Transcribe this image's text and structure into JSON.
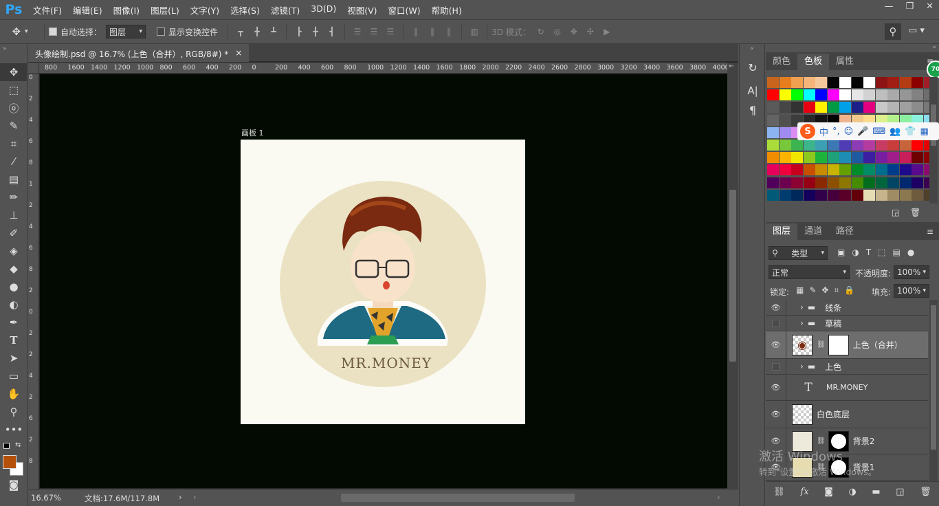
{
  "app": {
    "logo": "Ps"
  },
  "menu": [
    "文件(F)",
    "编辑(E)",
    "图像(I)",
    "图层(L)",
    "文字(Y)",
    "选择(S)",
    "滤镜(T)",
    "3D(D)",
    "视图(V)",
    "窗口(W)",
    "帮助(H)"
  ],
  "window_controls": {
    "minimize": "—",
    "restore": "❐",
    "close": "✕"
  },
  "options": {
    "auto_select_label": "自动选择：",
    "auto_select_checked": true,
    "auto_select_target": "图层",
    "show_transform_label": "显示变换控件",
    "show_transform_checked": false,
    "mode3d_label": "3D 模式："
  },
  "document": {
    "tab_title": "头像绘制.psd @ 16.7% (上色（合并）, RGB/8#) *",
    "tab_close": "×",
    "artboard_label": "画板 1",
    "ruler_h": [
      "800",
      "1600",
      "1400",
      "1200",
      "1000",
      "800",
      "600",
      "400",
      "200",
      "0",
      "200",
      "400",
      "600",
      "800",
      "1000",
      "1200",
      "1400",
      "1600",
      "1800",
      "2000",
      "2200",
      "2400",
      "2600",
      "2800",
      "3000",
      "3200",
      "3400",
      "3600",
      "3800",
      "4000"
    ],
    "ruler_v": [
      "0",
      "2",
      "4",
      "6",
      "8",
      "1",
      "2",
      "4",
      "6",
      "8",
      "2",
      "0",
      "2",
      "2",
      "4",
      "2",
      "6",
      "2",
      "8"
    ],
    "artwork_text": "MR.MONEY"
  },
  "status": {
    "zoom": "16.67%",
    "doc_size": "文档:17.6M/117.8M"
  },
  "panels": {
    "top_tabs": [
      "颜色",
      "色板",
      "属性"
    ],
    "top_active": "色板",
    "layer_tabs": [
      "图层",
      "通道",
      "路径"
    ],
    "layer_active": "图层",
    "filter_kind": "类型",
    "blend_mode": "正常",
    "opacity_label": "不透明度:",
    "opacity_value": "100%",
    "lock_label": "锁定:",
    "fill_label": "填充:",
    "fill_value": "100%"
  },
  "layers": [
    {
      "name": "线条",
      "type": "group",
      "visible": true
    },
    {
      "name": "草稿",
      "type": "group",
      "visible": false
    },
    {
      "name": "上色（合并）",
      "type": "image-mask",
      "visible": true,
      "selected": true
    },
    {
      "name": "上色",
      "type": "group",
      "visible": false
    },
    {
      "name": "MR.MONEY",
      "type": "text",
      "visible": true
    },
    {
      "name": "白色底层",
      "type": "image",
      "visible": true
    },
    {
      "name": "背景2",
      "type": "image-mask",
      "visible": true
    },
    {
      "name": "背景1",
      "type": "image-mask",
      "visible": true
    }
  ],
  "ime_bar": {
    "logo": "S",
    "lang": "中",
    "punct": "°,"
  },
  "watermark": {
    "line1": "激活 Windows",
    "line2": "转到\"设置\"以激活 Windows。"
  },
  "swatch_colors": [
    [
      "#c8641e",
      "#e87d1e",
      "#f0a050",
      "#f5b47a",
      "#f5c89b",
      "#050505",
      "#ffffff",
      "#050505",
      "#ffffff",
      "#8c1414",
      "#a01e14",
      "#b43c14",
      "#8c0000",
      "#a01e28"
    ],
    [
      "#ff0000",
      "#ffff00",
      "#00ff00",
      "#00ffff",
      "#0000ff",
      "#ff00ff",
      "#ffffff",
      "#e6e6e6",
      "#d2d2d2",
      "#bebebe",
      "#aaaaaa",
      "#969696",
      "#828282",
      "#6e6e6e"
    ],
    [
      "#5a5a5a",
      "#464646",
      "#323232",
      "#e60012",
      "#fff100",
      "#009944",
      "#00a0e9",
      "#1d2088",
      "#e4007f",
      "#c8c8c8",
      "#b4b4b4",
      "#a0a0a0",
      "#8c8c8c",
      "#787878"
    ],
    [
      "#646464",
      "#505050",
      "#3c3c3c",
      "#282828",
      "#141414",
      "#000000",
      "#f0b48c",
      "#f0c88c",
      "#fadc8c",
      "#dcf08c",
      "#b4f08c",
      "#8cf0a0",
      "#8cf0dc",
      "#8cdcf0"
    ],
    [
      "#8cb4f0",
      "#a08cf0",
      "#dc8cf0",
      "#f08cdc",
      "#f08ca0",
      "#f08c8c",
      "#f0a08c",
      "#64c878",
      "#50b4a0",
      "#3ca0c8",
      "#5064c8",
      "#8250c8",
      "#b450c8",
      "#c8508c"
    ],
    [
      "#aadc3c",
      "#78c83c",
      "#3cb450",
      "#3cb48c",
      "#3ca0b4",
      "#3c78b4",
      "#503cb4",
      "#8c3cb4",
      "#b43ca0",
      "#c83c64",
      "#c83c3c",
      "#c8643c",
      "#ff0000",
      "#e60000"
    ],
    [
      "#f08c00",
      "#fab400",
      "#f0e600",
      "#8cc81e",
      "#1eb43c",
      "#1ea078",
      "#1e8cb4",
      "#1e5aa0",
      "#3c1ea0",
      "#781ea0",
      "#a01e8c",
      "#c81e5a",
      "#6e0000",
      "#8c0000"
    ],
    [
      "#e6005a",
      "#f0003c",
      "#c8001e",
      "#c85000",
      "#c88c00",
      "#c8b400",
      "#64a000",
      "#008c28",
      "#008c64",
      "#006e8c",
      "#003c8c",
      "#1e0a8c",
      "#5a0a8c",
      "#8c0a6e"
    ],
    [
      "#50005a",
      "#6e0050",
      "#8c0032",
      "#960014",
      "#8c2800",
      "#8c5000",
      "#8c7800",
      "#468c00",
      "#006e1e",
      "#00643c",
      "#004664",
      "#00286e",
      "#1e0064",
      "#3c0050"
    ],
    [
      "#005a78",
      "#003c6e",
      "#00285a",
      "#14005a",
      "#32004b",
      "#46003c",
      "#5a0028",
      "#64000a",
      "#e6dcb4",
      "#c8b48c",
      "#a08c64",
      "#8c7850",
      "#6e5a3c",
      "#50402a"
    ]
  ]
}
